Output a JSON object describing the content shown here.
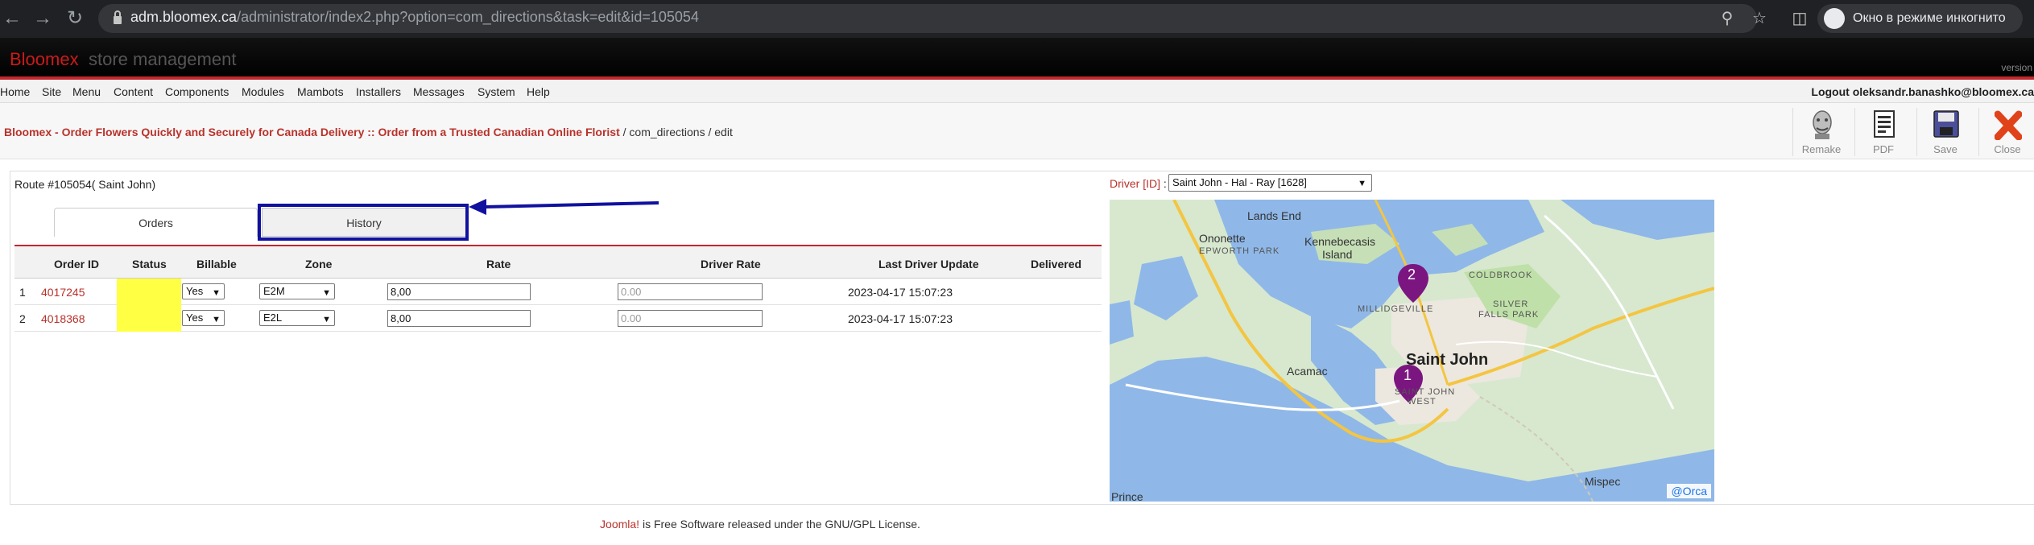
{
  "browser": {
    "url_host": "adm.bloomex.ca",
    "url_path": "/administrator/index2.php?option=com_directions&task=edit&id=105054",
    "incognito_label": "Окно в режиме инкогнито"
  },
  "header": {
    "brand": "Bloomex",
    "subtitle": "store management",
    "version": "version"
  },
  "menu": {
    "items": [
      "Home",
      "Site",
      "Menu",
      "Content",
      "Components",
      "Modules",
      "Mambots",
      "Installers",
      "Messages",
      "System",
      "Help"
    ],
    "logout": "Logout oleksandr.banashko@bloomex.ca"
  },
  "breadcrumb": {
    "site": "Bloomex - Order Flowers Quickly and Securely for Canada Delivery :: Order from a Trusted Canadian Online Florist",
    "rest": " / com_directions / edit"
  },
  "toolbar": {
    "remake": "Remake",
    "pdf": "PDF",
    "save": "Save",
    "close": "Close"
  },
  "route": {
    "title": "Route #105054( Saint John)",
    "tabs": {
      "orders": "Orders",
      "history": "History"
    }
  },
  "orders": {
    "headers": {
      "order_id": "Order ID",
      "status": "Status",
      "billable": "Billable",
      "zone": "Zone",
      "rate": "Rate",
      "driver_rate": "Driver Rate",
      "last_update": "Last Driver Update",
      "delivered": "Delivered"
    },
    "rows": [
      {
        "num": "1",
        "order_id": "4017245",
        "billable": "Yes",
        "zone": "E2M",
        "rate": "8,00",
        "driver_rate_placeholder": "0.00",
        "last_update": "2023-04-17 15:07:23"
      },
      {
        "num": "2",
        "order_id": "4018368",
        "billable": "Yes",
        "zone": "E2L",
        "rate": "8,00",
        "driver_rate_placeholder": "0.00",
        "last_update": "2023-04-17 15:07:23"
      }
    ]
  },
  "driver": {
    "label": "Driver [ID]",
    "colon": " :",
    "selected": "Saint John - Hal - Ray [1628]"
  },
  "map": {
    "labels": {
      "lands_end": "Lands End",
      "ononette": "Ononette",
      "epworth": "EPWORTH PARK",
      "kennebecasis": "Kennebecasis",
      "island": "Island",
      "coldbrook": "COLDBROOK",
      "millidgeville": "MILLIDGEVILLE",
      "silver": "SILVER",
      "falls": "FALLS PARK",
      "saint_john": "Saint John",
      "acamac": "Acamac",
      "sj_west1": "SAINT JOHN",
      "sj_west2": "WEST",
      "prince": "Prince",
      "mispec": "Mispec"
    },
    "markers": [
      "1",
      "2"
    ],
    "attribution": "@Orca"
  },
  "footer": {
    "joomla": "Joomla!",
    "text": " is Free Software released under the GNU/GPL License."
  }
}
